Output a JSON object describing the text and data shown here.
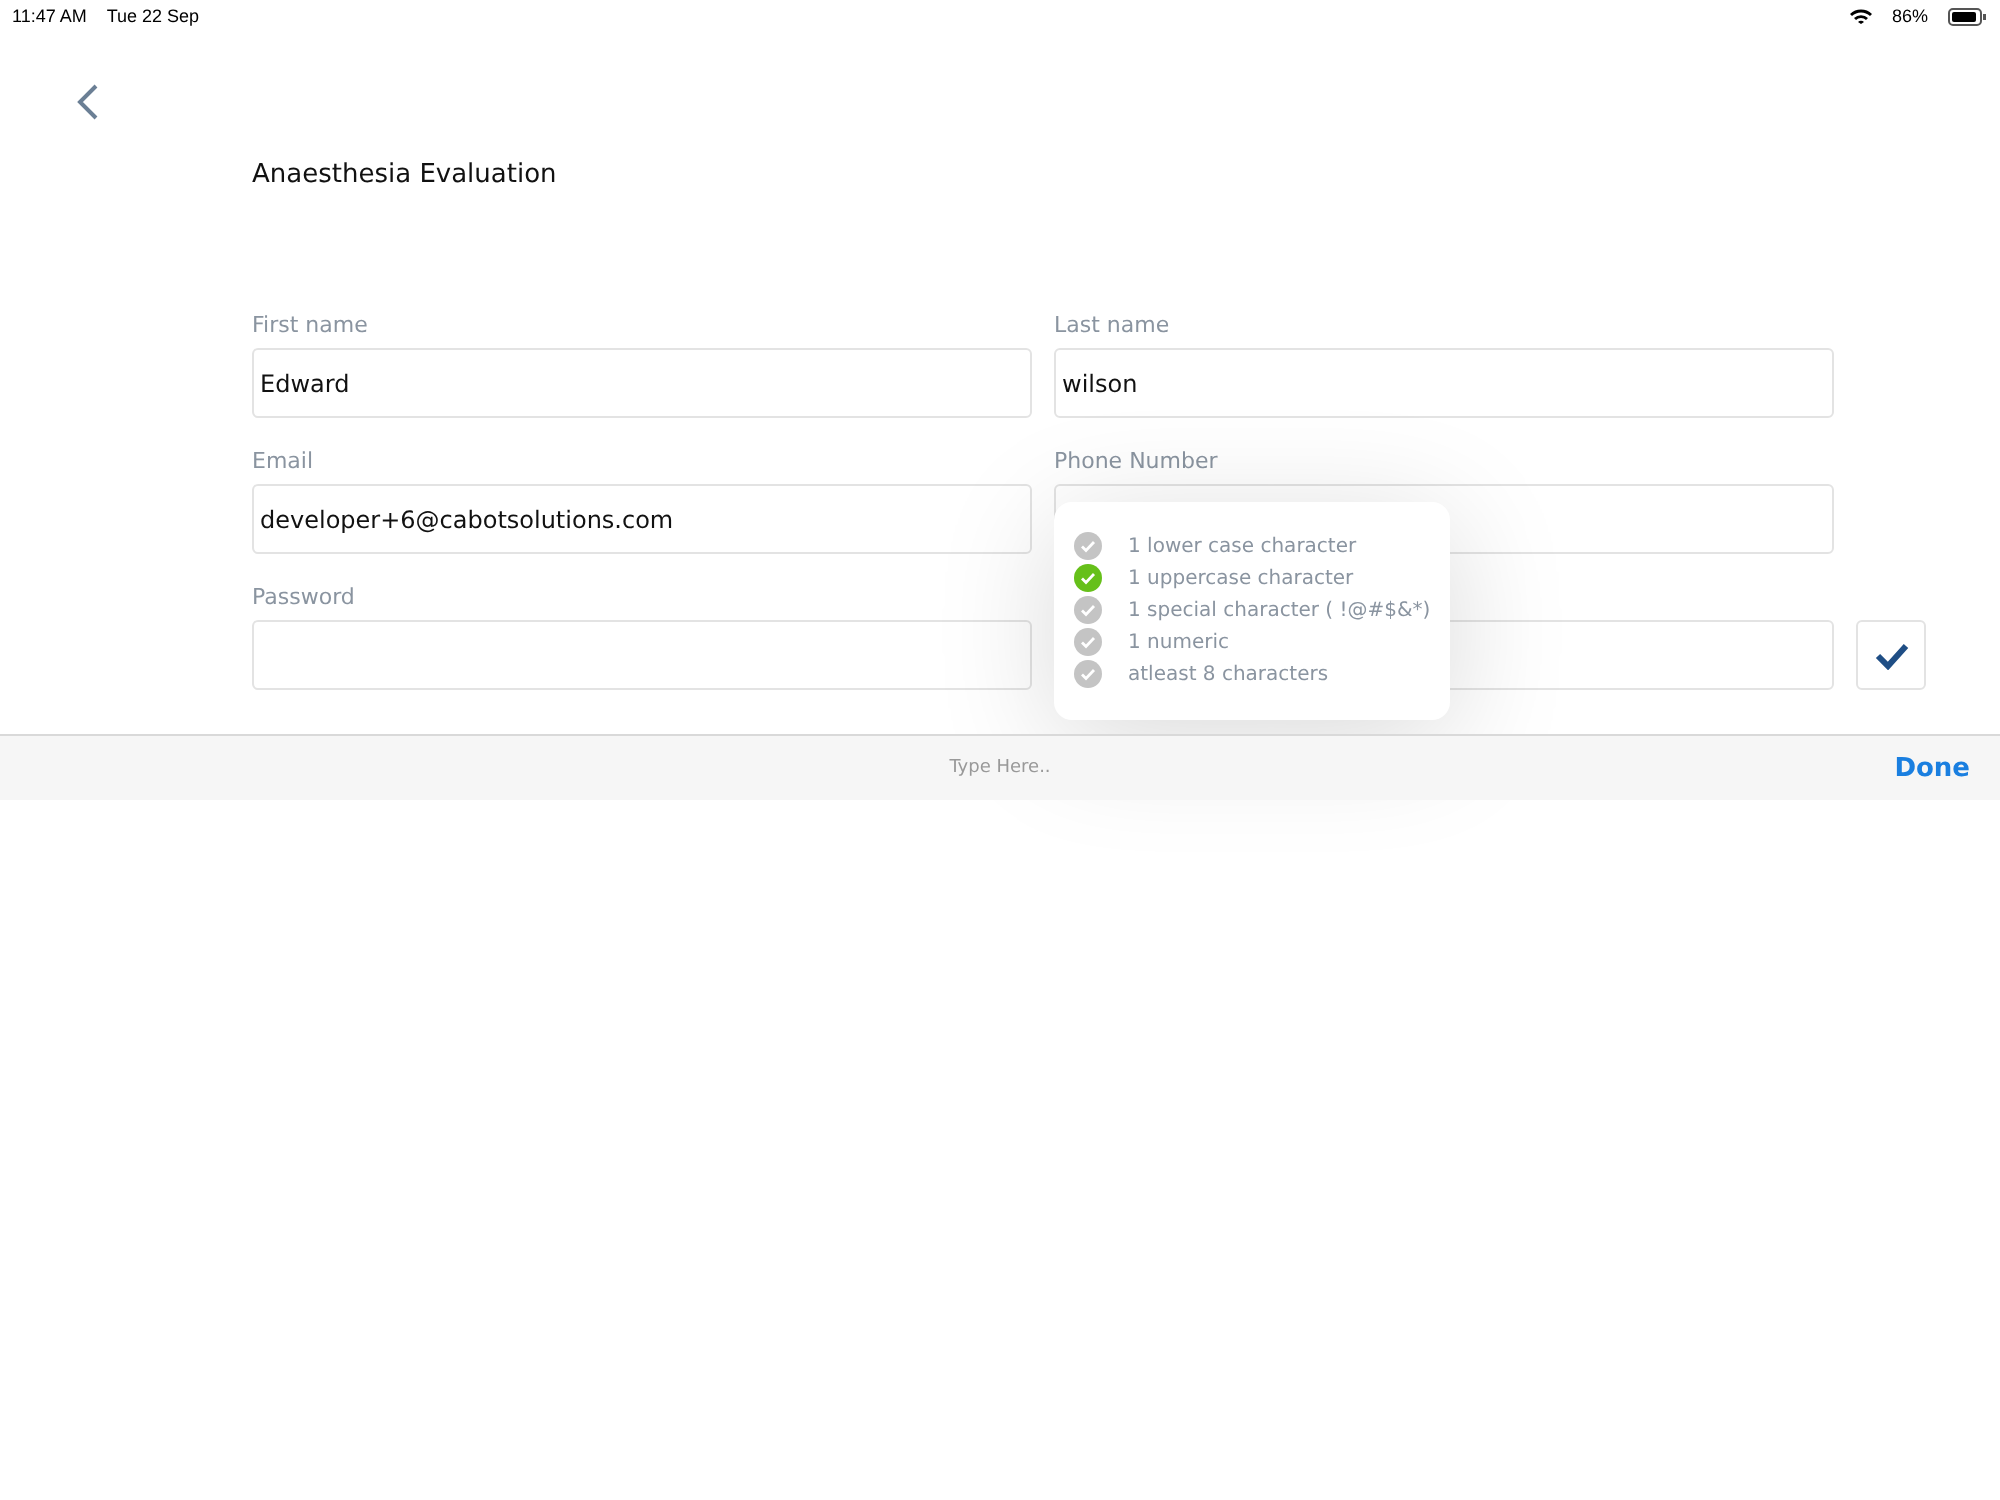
{
  "status_bar": {
    "time": "11:47 AM",
    "date": "Tue 22 Sep",
    "battery": "86%"
  },
  "title": "Anaesthesia Evaluation",
  "fields": [
    {
      "label": "First name",
      "value": "Edward",
      "kind": "text"
    },
    {
      "label": "Last name",
      "value": "wilson",
      "kind": "text"
    },
    {
      "label": "Email",
      "value": "developer+6@cabotsolutions.com",
      "kind": "text"
    },
    {
      "label": "Phone Number",
      "kind": "text"
    },
    {
      "label": "Password",
      "kind": "password"
    },
    {
      "kind": "password"
    }
  ],
  "confirm_button": {
    "checked": true
  },
  "password_rules": [
    {
      "label": "1 lower case character",
      "checked": false
    },
    {
      "label": "1 uppercase character",
      "checked": true
    },
    {
      "label": "1 special character ( !@#$&*)",
      "checked": false
    },
    {
      "label": "1 numeric",
      "checked": false
    },
    {
      "label": "atleast 8 characters",
      "checked": false
    }
  ],
  "keyboard_bar": {
    "placeholder": "Type Here..",
    "done": "Done"
  }
}
